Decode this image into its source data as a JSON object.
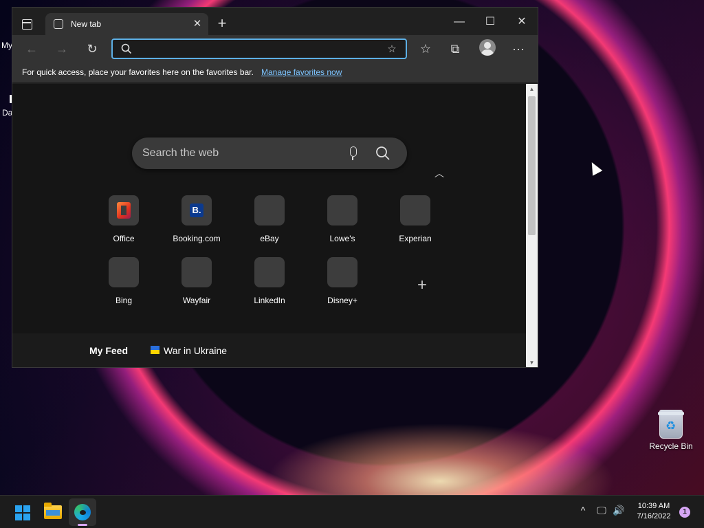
{
  "desktop": {
    "partial_icon_1": "My",
    "partial_icon_2": "Da",
    "recycle_bin_label": "Recycle Bin"
  },
  "browser": {
    "tab_title": "New tab",
    "window_controls": {
      "minimize": "—",
      "maximize": "☐",
      "close": "✕"
    },
    "address_bar": {
      "value": "",
      "placeholder": ""
    },
    "favorites_bar": {
      "message": "For quick access, place your favorites here on the favorites bar.",
      "link": "Manage favorites now"
    },
    "new_tab_page": {
      "search_placeholder": "Search the web",
      "quick_links": [
        {
          "label": "Office",
          "icon": "office-logo"
        },
        {
          "label": "Booking.com",
          "icon": "booking-logo",
          "glyph": "B."
        },
        {
          "label": "eBay",
          "icon": "blank"
        },
        {
          "label": "Lowe's",
          "icon": "blank"
        },
        {
          "label": "Experian",
          "icon": "blank"
        },
        {
          "label": "Bing",
          "icon": "blank"
        },
        {
          "label": "Wayfair",
          "icon": "blank"
        },
        {
          "label": "LinkedIn",
          "icon": "blank"
        },
        {
          "label": "Disney+",
          "icon": "blank"
        }
      ],
      "feed": {
        "my_feed": "My Feed",
        "topic": "War in Ukraine"
      }
    }
  },
  "taskbar": {
    "time": "10:39 AM",
    "date": "7/16/2022",
    "notification_count": "1"
  },
  "colors": {
    "accent_focus": "#5db0e6",
    "link": "#7cc4ff",
    "notification": "#d7a6f5"
  }
}
